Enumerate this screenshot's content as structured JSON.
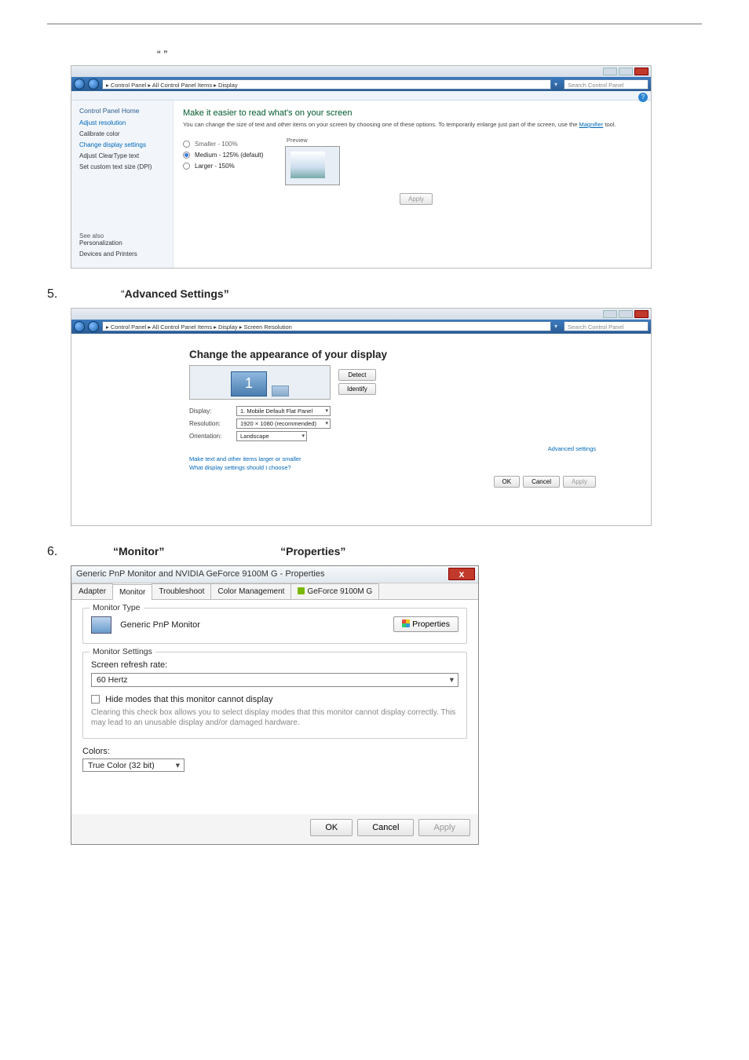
{
  "steps": {
    "s4_quote": "“                                                ”",
    "s5_num": "5.",
    "s5_text_prefix": "“",
    "s5_text_bold": "Advanced Settings”",
    "s6_num": "6.",
    "s6_b1": "“Monitor”",
    "s6_b2": "“Properties”"
  },
  "fig1": {
    "breadcrumb": "▸ Control Panel ▸ All Control Panel Items ▸ Display",
    "search_ph": "Search Control Panel",
    "sidebar": {
      "home": "Control Panel Home",
      "items": [
        "Adjust resolution",
        "Calibrate color",
        "Change display settings",
        "Adjust ClearType text",
        "Set custom text size (DPI)"
      ],
      "seealso_hdr": "See also",
      "seealso": [
        "Personalization",
        "Devices and Printers"
      ]
    },
    "title": "Make it easier to read what's on your screen",
    "desc": "You can change the size of text and other items on your screen by choosing one of these options. To temporarily enlarge just part of the screen, use the ",
    "magnifier": "Magnifier",
    "desc_tail": " tool.",
    "opts": {
      "smaller": "Smaller - 100%",
      "medium": "Medium - 125% (default)",
      "larger": "Larger - 150%"
    },
    "preview": "Preview",
    "apply": "Apply"
  },
  "fig2": {
    "breadcrumb": "▸ Control Panel ▸ All Control Panel Items ▸ Display ▸ Screen Resolution",
    "search_ph": "Search Control Panel",
    "title": "Change the appearance of your display",
    "detect": "Detect",
    "identify": "Identify",
    "mon_num": "1",
    "fields": {
      "display_l": "Display:",
      "display_v": "1. Mobile Default Flat Panel",
      "res_l": "Resolution:",
      "res_v": "1920 × 1080 (recommended)",
      "orient_l": "Orientation:",
      "orient_v": "Landscape"
    },
    "adv": "Advanced settings",
    "hint1": "Make text and other items larger or smaller",
    "hint2": "What display settings should I choose?",
    "ok": "OK",
    "cancel": "Cancel",
    "apply": "Apply"
  },
  "fig3": {
    "title": "Generic PnP Monitor and NVIDIA GeForce 9100M G - Properties",
    "tabs": [
      "Adapter",
      "Monitor",
      "Troubleshoot",
      "Color Management",
      "GeForce 9100M G"
    ],
    "grp1": {
      "legend": "Monitor Type",
      "name": "Generic PnP Monitor",
      "prop_btn": "Properties"
    },
    "grp2": {
      "legend": "Monitor Settings",
      "rate_lbl": "Screen refresh rate:",
      "rate_val": "60 Hertz",
      "hide_chk": "Hide modes that this monitor cannot display",
      "hint": "Clearing this check box allows you to select display modes that this monitor cannot display correctly. This may lead to an unusable display and/or damaged hardware."
    },
    "grp3": {
      "legend": "Colors:",
      "val": "True Color (32 bit)"
    },
    "ok": "OK",
    "cancel": "Cancel",
    "apply": "Apply"
  }
}
